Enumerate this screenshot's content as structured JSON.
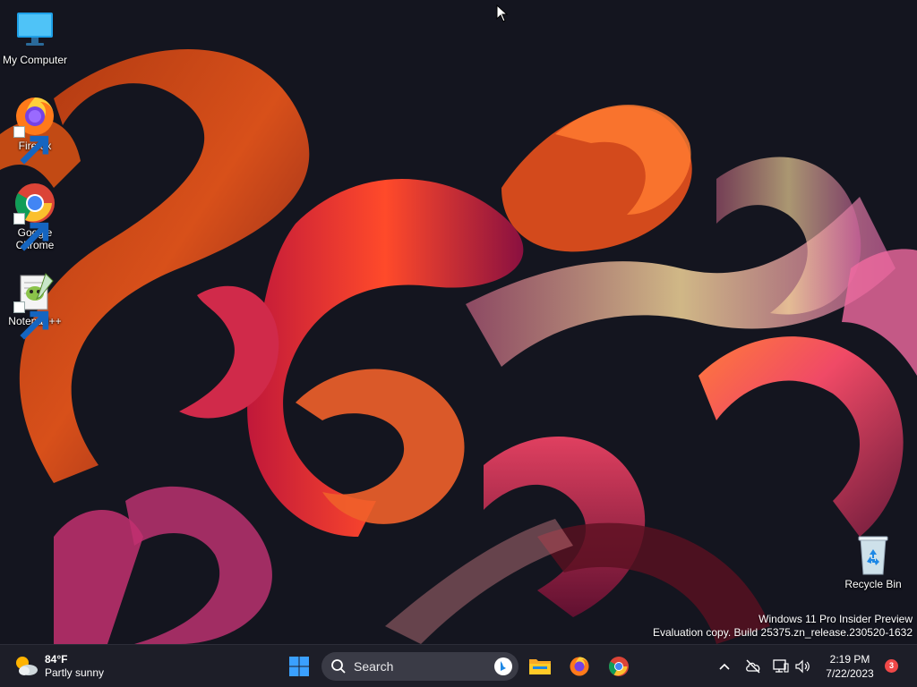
{
  "desktop": {
    "icons": [
      {
        "label": "My Computer",
        "icon": "monitor-icon"
      },
      {
        "label": "Firefox",
        "icon": "firefox-icon"
      },
      {
        "label": "Google Chrome",
        "icon": "chrome-icon"
      },
      {
        "label": "Notepad++",
        "icon": "notepadpp-icon"
      },
      {
        "label": "Recycle Bin",
        "icon": "recycle-bin-icon"
      }
    ],
    "watermark": {
      "line1": "Windows 11 Pro Insider Preview",
      "line2": "Evaluation copy. Build 25375.zn_release.230520-1632"
    }
  },
  "taskbar": {
    "weather": {
      "temperature": "84°F",
      "condition": "Partly sunny",
      "icon": "partly-sunny-icon"
    },
    "search": {
      "label": "Search"
    },
    "pinned": [
      {
        "name": "start",
        "icon": "windows-start-icon"
      },
      {
        "name": "file-explorer",
        "icon": "folder-icon"
      },
      {
        "name": "firefox",
        "icon": "firefox-icon"
      },
      {
        "name": "chrome",
        "icon": "chrome-icon"
      }
    ],
    "tray": {
      "icons": [
        "chevron-up-icon",
        "cloud-offline-icon",
        "network-icon",
        "volume-icon"
      ],
      "time": "2:19 PM",
      "date": "7/22/2023",
      "notification_count": "3"
    }
  },
  "colors": {
    "taskbar_bg": "#1d1e28",
    "desktop_bg": "#14151f",
    "accent_blue": "#1e90ff",
    "badge_red": "#f04848"
  }
}
